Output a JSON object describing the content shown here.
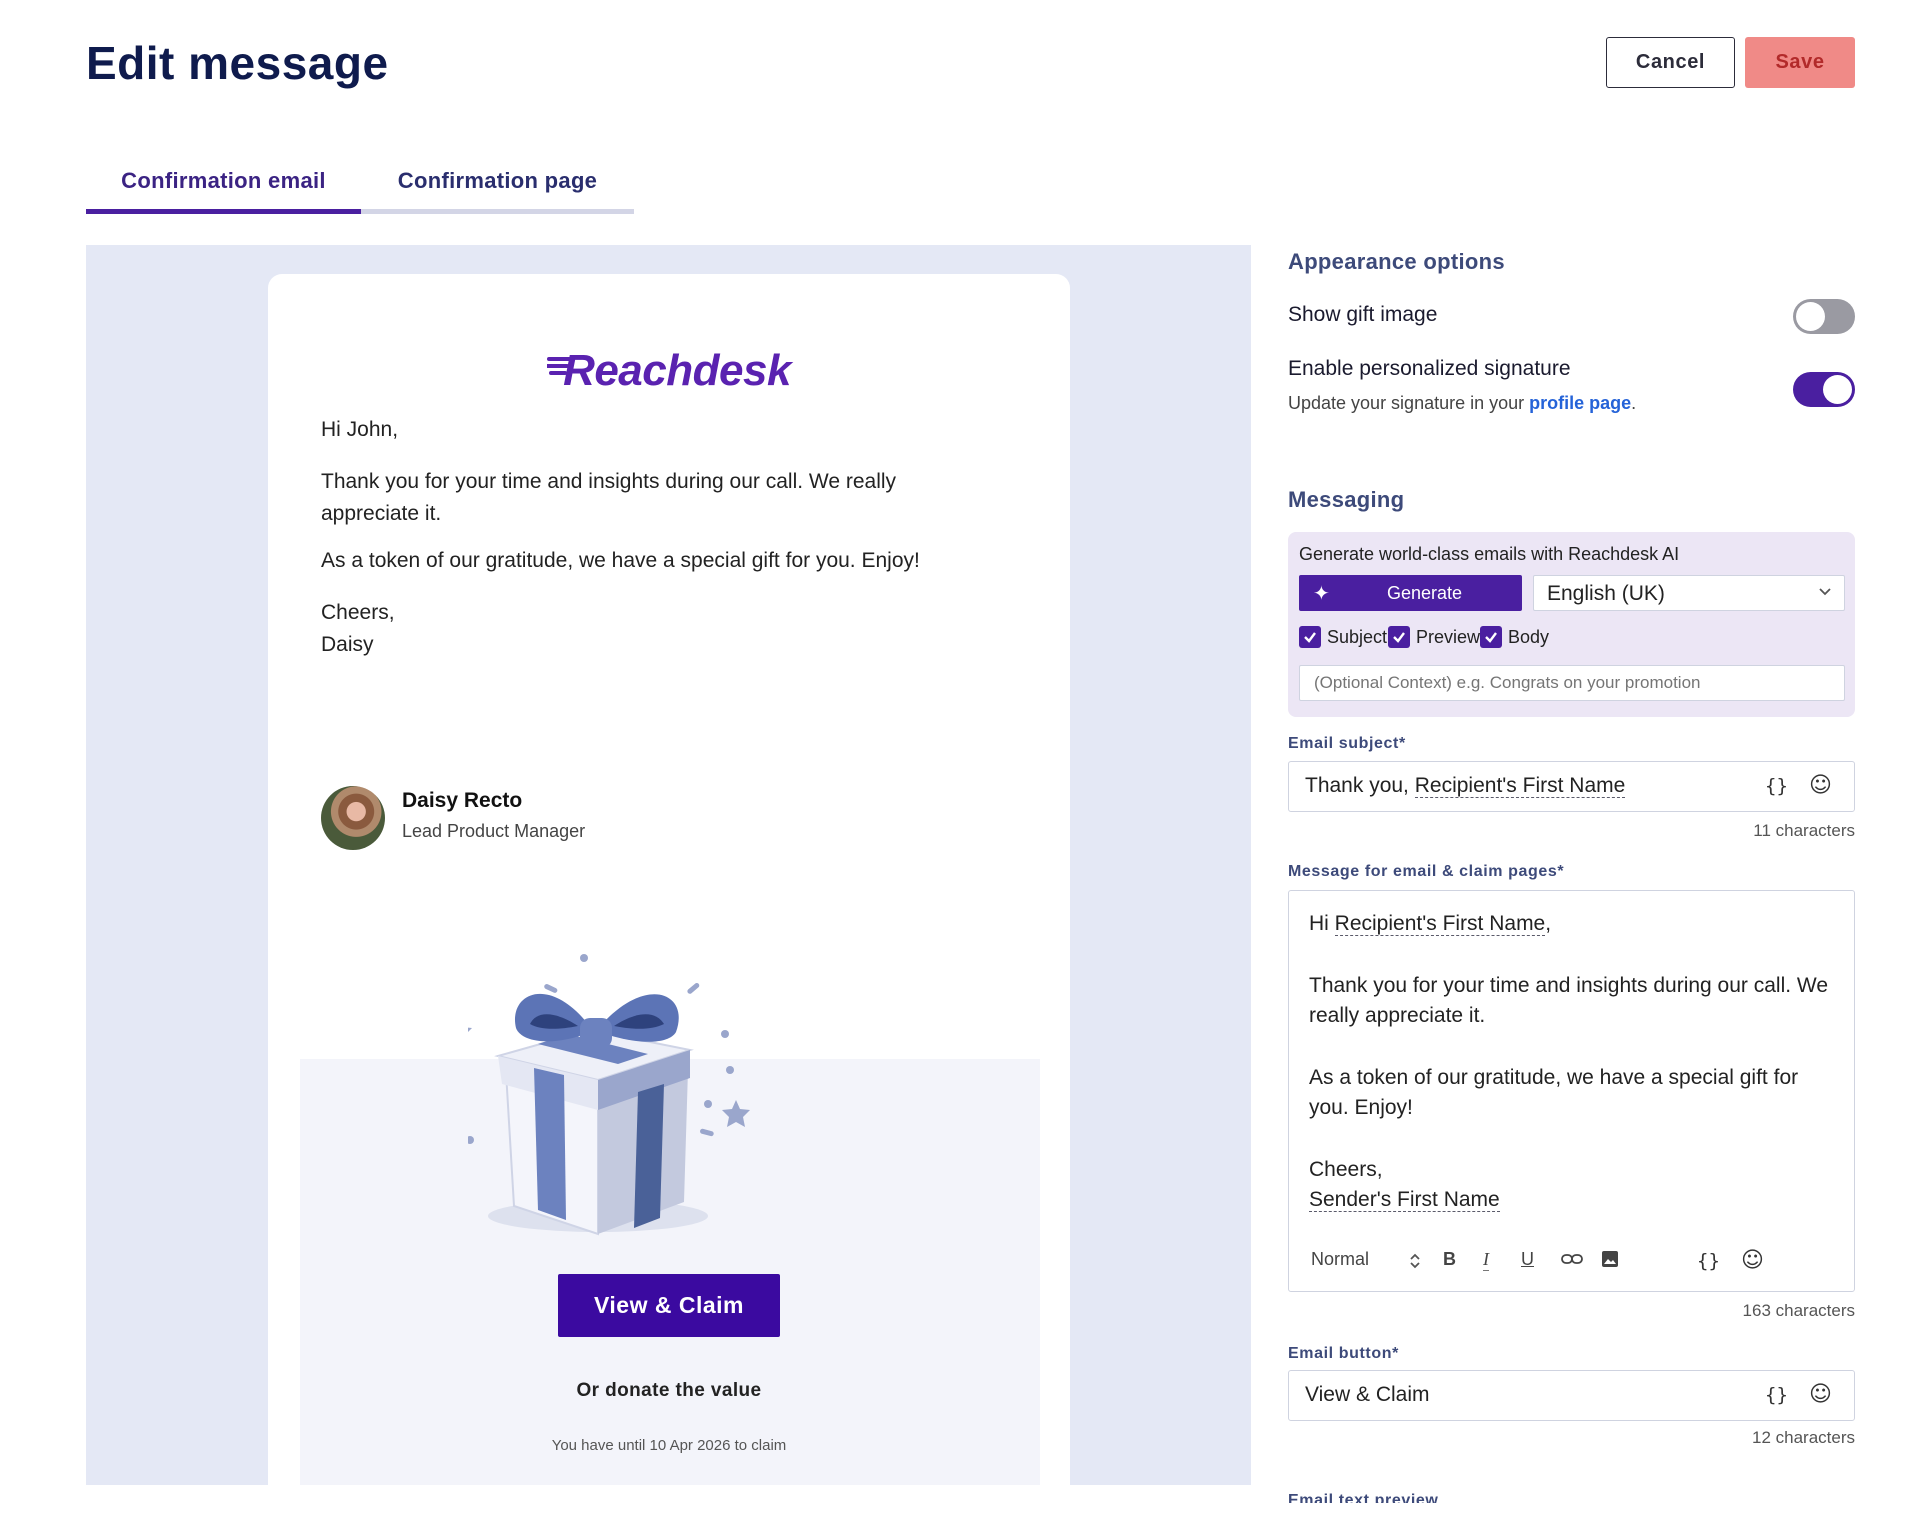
{
  "header": {
    "title": "Edit message",
    "cancel_label": "Cancel",
    "save_label": "Save"
  },
  "tabs": [
    {
      "label": "Confirmation email",
      "active": true
    },
    {
      "label": "Confirmation page",
      "active": false
    }
  ],
  "preview": {
    "logo_text": "Reachdesk",
    "greeting": "Hi John,",
    "paragraph1": "Thank you for your time and insights during our call. We really appreciate it.",
    "paragraph2": "As a token of our gratitude, we have a special gift for you. Enjoy!",
    "closing": "Cheers,\nDaisy",
    "signature_name": "Daisy Recto",
    "signature_role": "Lead Product Manager",
    "button_label": "View & Claim",
    "donate_text": "Or donate the value",
    "deadline_text": "You have until 10 Apr 2026 to claim"
  },
  "appearance": {
    "heading": "Appearance options",
    "show_gift_image": {
      "label": "Show gift image",
      "enabled": false
    },
    "personalized_signature": {
      "label": "Enable personalized signature",
      "help_prefix": "Update your signature in your ",
      "help_link": "profile page",
      "help_suffix": ".",
      "enabled": true
    }
  },
  "messaging": {
    "heading": "Messaging",
    "ai": {
      "title": "Generate world-class emails with Reachdesk AI",
      "generate_label": "Generate",
      "language": "English (UK)",
      "checkboxes": [
        {
          "label": "Subject",
          "checked": true
        },
        {
          "label": "Preview",
          "checked": true
        },
        {
          "label": "Body",
          "checked": true
        }
      ],
      "context_placeholder": "(Optional Context) e.g. Congrats on your promotion"
    },
    "subject": {
      "label": "Email subject*",
      "prefix": "Thank you, ",
      "token": "Recipient's First Name",
      "count": "11 characters"
    },
    "message": {
      "label": "Message for email & claim pages*",
      "greeting_prefix": "Hi ",
      "greeting_token": "Recipient's First Name",
      "greeting_suffix": ",",
      "paragraph1": "Thank you for your time and insights during our call. We really appreciate it.",
      "paragraph2": "As a token of our gratitude, we have a special gift for you. Enjoy!",
      "closing": "Cheers,",
      "sender_token": "Sender's First Name",
      "format": "Normal",
      "count": "163 characters"
    },
    "button": {
      "label": "Email button*",
      "value": "View & Claim",
      "count": "12 characters"
    },
    "text_preview_label": "Email text preview"
  },
  "icons": {
    "variables": "{}",
    "emoji": "☺",
    "bold": "B",
    "italic": "I",
    "underline": "U",
    "sparkle": "✦"
  },
  "colors": {
    "brand": "#4a1fa0",
    "save": "#f08a87",
    "link": "#2563d8"
  }
}
